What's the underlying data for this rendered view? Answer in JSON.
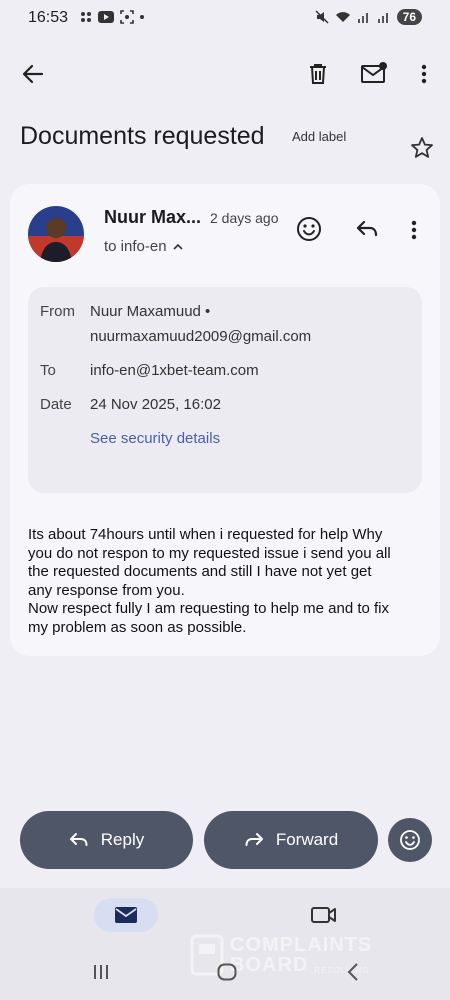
{
  "status": {
    "time": "16:53",
    "battery": "76"
  },
  "email": {
    "subject": "Documents requested",
    "add_label": "Add label",
    "sender_name": "Nuur Max...",
    "time_ago": "2 days ago",
    "to_summary": "to info-en",
    "details": {
      "from_label": "From",
      "from_name": "Nuur Maxamuud •",
      "from_email": "nuurmaxamuud2009@gmail.com",
      "to_label": "To",
      "to_value": "info-en@1xbet-team.com",
      "date_label": "Date",
      "date_value": "24 Nov 2025, 16:02",
      "security_link": "See security details"
    },
    "body_lines": [
      "Its about 74hours until when i requested for help Why",
      "you do not respon to my requested issue i send you all",
      "the requested documents and still I have not yet get",
      "any response from you.",
      "Now respect fully I am requesting to help me and to fix",
      "my problem as soon as possible."
    ]
  },
  "actions": {
    "reply": "Reply",
    "forward": "Forward"
  },
  "watermark": {
    "line1": "COMPLAINTS",
    "line2": "BOARD",
    "small": "RESOLVING"
  },
  "icons": {
    "back": "arrow-back-icon",
    "delete": "trash-icon",
    "mark_unread": "mail-unread-icon",
    "more": "more-vert-icon",
    "star": "star-icon",
    "emoji": "emoji-icon",
    "reply": "reply-icon",
    "forward": "forward-icon",
    "mail_tab": "mail-icon",
    "meet_tab": "video-icon"
  }
}
